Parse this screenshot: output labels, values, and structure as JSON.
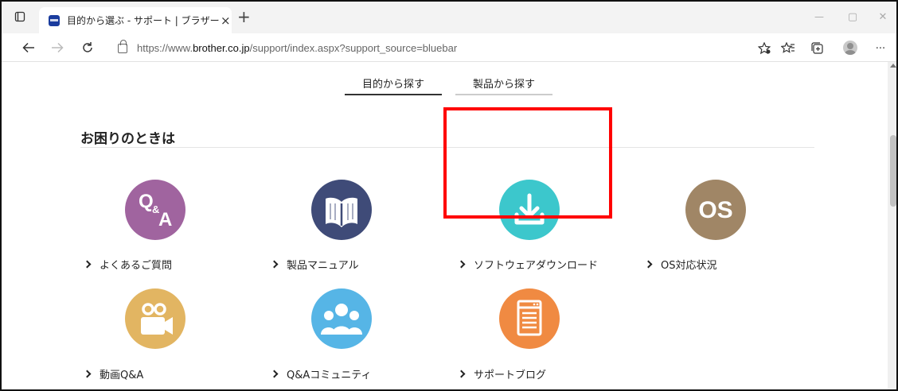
{
  "browser": {
    "tab_title": "目的から選ぶ - サポート | ブラザー",
    "tab_close": "×",
    "new_tab": "+",
    "url_host_prefix": "https://www.",
    "url_host": "brother.co.jp",
    "url_path": "/support/index.aspx?support_source=bluebar",
    "window_minimize": "—",
    "window_maximize": "▢",
    "window_close": "✕",
    "more_menu": "···"
  },
  "page": {
    "search_tabs": [
      {
        "label": "目的から探す",
        "active": true,
        "underline_color": "#333333"
      },
      {
        "label": "製品から探す",
        "active": false,
        "underline_color": "#cccccc"
      }
    ],
    "section_title": "お困りのときは",
    "items": [
      {
        "label": "よくあるご質問",
        "icon": "qa-icon",
        "color": "#a0649f",
        "glyph": "Q&A"
      },
      {
        "label": "製品マニュアル",
        "icon": "book-icon",
        "color": "#3f4b78",
        "glyph": ""
      },
      {
        "label": "ソフトウェアダウンロード",
        "icon": "download-icon",
        "color": "#3cc7cc",
        "glyph": ""
      },
      {
        "label": "OS対応状況",
        "icon": "os-icon",
        "color": "#a08666",
        "glyph": "OS"
      },
      {
        "label": "動画Q&A",
        "icon": "video-camera-icon",
        "color": "#e2b562",
        "glyph": ""
      },
      {
        "label": "Q&Aコミュニティ",
        "icon": "community-icon",
        "color": "#56b5e6",
        "glyph": ""
      },
      {
        "label": "サポートブログ",
        "icon": "blog-icon",
        "color": "#f08a42",
        "glyph": ""
      }
    ],
    "highlight_color": "#ff0000"
  }
}
